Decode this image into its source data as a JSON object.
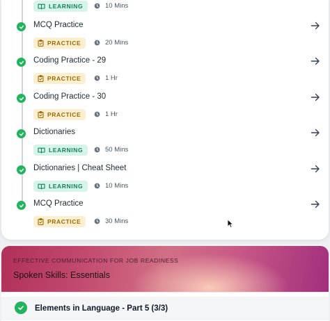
{
  "module_items": [
    {
      "title": "",
      "badge": "LEARNING",
      "badge_type": "learning",
      "duration": "10 Mins"
    },
    {
      "title": "MCQ Practice",
      "badge": "PRACTICE",
      "badge_type": "practice",
      "duration": "20 Mins"
    },
    {
      "title": "Coding Practice - 29",
      "badge": "PRACTICE",
      "badge_type": "practice",
      "duration": "1 Hr"
    },
    {
      "title": "Coding Practice - 30",
      "badge": "PRACTICE",
      "badge_type": "practice",
      "duration": "1 Hr"
    },
    {
      "title": "Dictionaries",
      "badge": "LEARNING",
      "badge_type": "learning",
      "duration": "50 Mins"
    },
    {
      "title": "Dictionaries | Cheat Sheet",
      "badge": "LEARNING",
      "badge_type": "learning",
      "duration": "10 Mins"
    },
    {
      "title": "MCQ Practice",
      "badge": "PRACTICE",
      "badge_type": "practice",
      "duration": "30 Mins"
    }
  ],
  "course_banner": {
    "eyebrow": "EFFECTIVE COMMUNICATION FOR JOB READINESS",
    "title": "Spoken Skills: Essentials"
  },
  "section": {
    "title": "Elements in Language - Part 5 (3/3)"
  },
  "colors": {
    "complete_green": "#22b35e",
    "learning_bg": "#d6f5ea",
    "learning_text": "#13805a",
    "practice_bg": "#fbefcf",
    "practice_text": "#9a6a05"
  },
  "icons": {
    "status": "check-circle-icon",
    "learning": "book-open-icon",
    "practice": "clipboard-icon",
    "duration": "clock-icon",
    "open": "arrow-right-icon"
  }
}
